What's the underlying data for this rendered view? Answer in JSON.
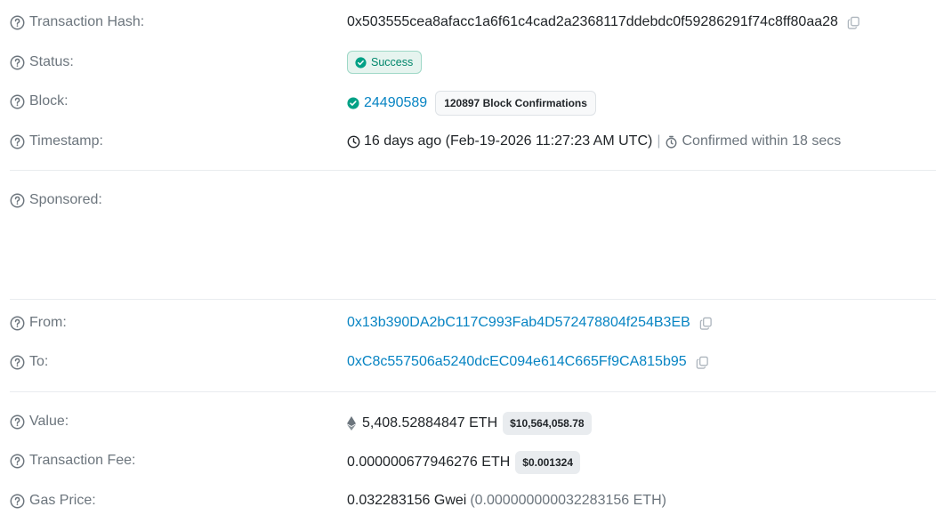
{
  "transaction_hash": {
    "label": "Transaction Hash:",
    "value": "0x503555cea8afacc1a6f61c4cad2a2368117ddebdc0f59286291f74c8ff80aa28"
  },
  "status": {
    "label": "Status:",
    "badge": "Success",
    "badge_color": "#00866b"
  },
  "block": {
    "label": "Block:",
    "number": "24490589",
    "confirmations": "120897 Block Confirmations"
  },
  "timestamp": {
    "label": "Timestamp:",
    "value": "16 days ago (Feb-19-2026 11:27:23 AM UTC)",
    "separator": "|",
    "confirmed": "Confirmed within 18 secs"
  },
  "sponsored": {
    "label": "Sponsored:"
  },
  "from": {
    "label": "From:",
    "address": "0x13b390DA2bC117C993Fab4D572478804f254B3EB"
  },
  "to": {
    "label": "To:",
    "address": "0xC8c557506a5240dcEC094e614C665Ff9CA815b95"
  },
  "value": {
    "label": "Value:",
    "amount": "5,408.52884847 ETH",
    "usd": "$10,564,058.78"
  },
  "transaction_fee": {
    "label": "Transaction Fee:",
    "amount": "0.000000677946276 ETH",
    "usd": "$0.001324"
  },
  "gas_price": {
    "label": "Gas Price:",
    "gwei": "0.032283156 Gwei",
    "eth": "(0.000000000032283156 ETH)"
  },
  "colors": {
    "link": "#0784c3",
    "label": "#6c757d",
    "success": "#00a186"
  },
  "icons": {
    "help": "question-circle-icon",
    "copy": "copy-icon",
    "check": "check-circle-icon",
    "clock": "clock-icon",
    "stopwatch": "stopwatch-icon",
    "eth": "ethereum-icon"
  }
}
